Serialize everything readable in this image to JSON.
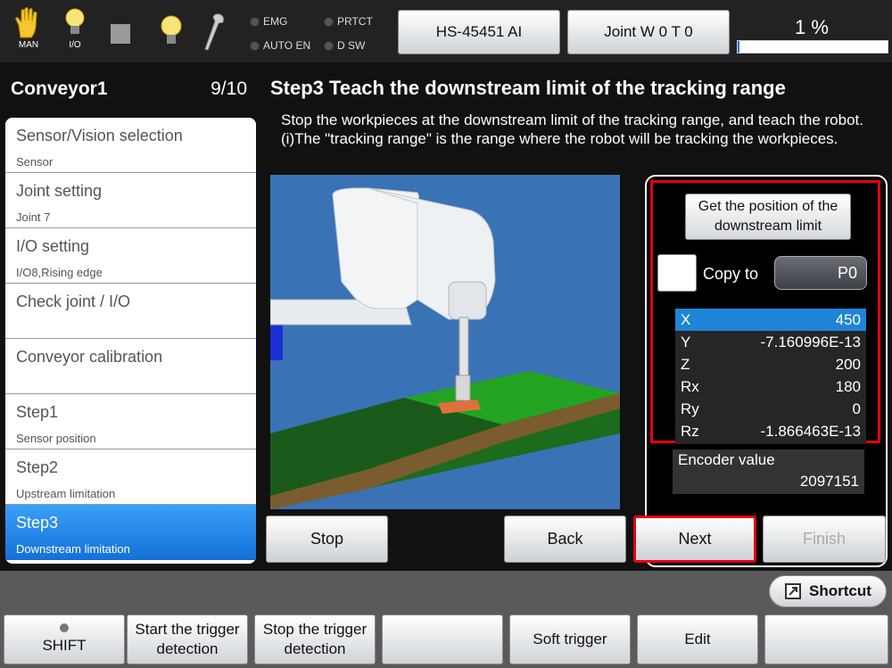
{
  "topbar": {
    "mode_label": "MAN",
    "io_label": "I/O",
    "lamps": {
      "emg": "EMG",
      "prtct": "PRTCT",
      "auto_en": "AUTO EN",
      "dsw": "D SW"
    },
    "robot_button": "HS-45451 AI",
    "joint_button": "Joint  W 0 T 0",
    "speed_label": "1 %",
    "speed_fraction": 0.01,
    "icons": [
      "hand-icon",
      "bulb-io-icon",
      "stop-square-icon",
      "bulb-icon",
      "wrench-icon"
    ]
  },
  "sidebar": {
    "title": "Conveyor1",
    "page": "9/10",
    "items": [
      {
        "title": "Sensor/Vision selection",
        "sub": "Sensor"
      },
      {
        "title": "Joint setting",
        "sub": "Joint 7"
      },
      {
        "title": "I/O setting",
        "sub": "I/O8,Rising edge"
      },
      {
        "title": "Check joint / I/O",
        "sub": ""
      },
      {
        "title": "Conveyor calibration",
        "sub": ""
      },
      {
        "title": "Step1",
        "sub": "Sensor position"
      },
      {
        "title": "Step2",
        "sub": "Upstream limitation"
      },
      {
        "title": "Step3",
        "sub": "Downstream limitation"
      }
    ]
  },
  "main": {
    "heading": "Step3 Teach the downstream limit of the tracking range",
    "description": "Stop the workpieces at the downstream limit of the tracking range, and teach the robot. (i)The \"tracking range\" is the range where the robot will be tracking the workpieces.",
    "get_position_button": "Get the position of the downstream limit",
    "copy_to_label": "Copy to",
    "copy_target": "P0",
    "coords": [
      {
        "axis": "X",
        "value": "450"
      },
      {
        "axis": "Y",
        "value": "-7.160996E-13"
      },
      {
        "axis": "Z",
        "value": "200"
      },
      {
        "axis": "Rx",
        "value": "180"
      },
      {
        "axis": "Ry",
        "value": "0"
      },
      {
        "axis": "Rz",
        "value": "-1.866463E-13"
      }
    ],
    "encoder_label": "Encoder value",
    "encoder_value": "2097151",
    "buttons": {
      "stop": "Stop",
      "back": "Back",
      "next": "Next",
      "finish": "Finish"
    }
  },
  "footer": {
    "shortcut": "Shortcut",
    "shift": "SHIFT",
    "start_trigger": [
      "Start the trigger",
      "detection"
    ],
    "stop_trigger": [
      "Stop the trigger",
      "detection"
    ],
    "soft_trigger": "Soft trigger",
    "edit": "Edit"
  },
  "colors": {
    "accent_blue": "#1f84d6",
    "highlight_red": "#e60012",
    "active_step": "#1470d8"
  }
}
